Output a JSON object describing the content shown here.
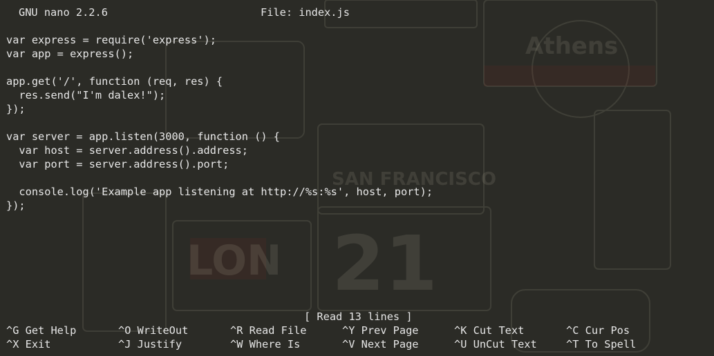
{
  "app": {
    "name_version": "GNU nano 2.2.6",
    "file_label": "File: index.js"
  },
  "editor": {
    "lines": [
      "var express = require('express');",
      "var app = express();",
      "",
      "app.get('/', function (req, res) {",
      "  res.send(\"I'm dalex!\");",
      "});",
      "",
      "var server = app.listen(3000, function () {",
      "  var host = server.address().address;",
      "  var port = server.address().port;",
      "",
      "  console.log('Example app listening at http://%s:%s', host, port);",
      "});"
    ]
  },
  "status": {
    "message": "[ Read 13 lines ]"
  },
  "shortcuts": {
    "row1": [
      {
        "label": "^G Get Help"
      },
      {
        "label": "^O WriteOut"
      },
      {
        "label": "^R Read File"
      },
      {
        "label": "^Y Prev Page"
      },
      {
        "label": "^K Cut Text"
      },
      {
        "label": "^C Cur Pos"
      }
    ],
    "row2": [
      {
        "label": "^X Exit"
      },
      {
        "label": "^J Justify"
      },
      {
        "label": "^W Where Is"
      },
      {
        "label": "^V Next Page"
      },
      {
        "label": "^U UnCut Text"
      },
      {
        "label": "^T To Spell"
      }
    ]
  },
  "colors": {
    "background": "#2b2b26",
    "text": "#e8e8e8"
  }
}
